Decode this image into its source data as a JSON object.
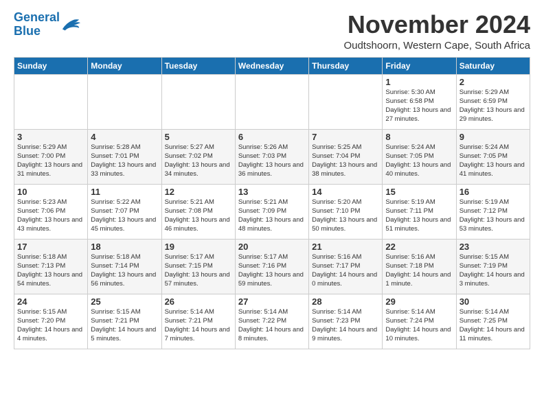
{
  "logo": {
    "line1": "General",
    "line2": "Blue"
  },
  "title": "November 2024",
  "location": "Oudtshoorn, Western Cape, South Africa",
  "weekdays": [
    "Sunday",
    "Monday",
    "Tuesday",
    "Wednesday",
    "Thursday",
    "Friday",
    "Saturday"
  ],
  "weeks": [
    [
      {
        "day": "",
        "info": ""
      },
      {
        "day": "",
        "info": ""
      },
      {
        "day": "",
        "info": ""
      },
      {
        "day": "",
        "info": ""
      },
      {
        "day": "",
        "info": ""
      },
      {
        "day": "1",
        "info": "Sunrise: 5:30 AM\nSunset: 6:58 PM\nDaylight: 13 hours\nand 27 minutes."
      },
      {
        "day": "2",
        "info": "Sunrise: 5:29 AM\nSunset: 6:59 PM\nDaylight: 13 hours\nand 29 minutes."
      }
    ],
    [
      {
        "day": "3",
        "info": "Sunrise: 5:29 AM\nSunset: 7:00 PM\nDaylight: 13 hours\nand 31 minutes."
      },
      {
        "day": "4",
        "info": "Sunrise: 5:28 AM\nSunset: 7:01 PM\nDaylight: 13 hours\nand 33 minutes."
      },
      {
        "day": "5",
        "info": "Sunrise: 5:27 AM\nSunset: 7:02 PM\nDaylight: 13 hours\nand 34 minutes."
      },
      {
        "day": "6",
        "info": "Sunrise: 5:26 AM\nSunset: 7:03 PM\nDaylight: 13 hours\nand 36 minutes."
      },
      {
        "day": "7",
        "info": "Sunrise: 5:25 AM\nSunset: 7:04 PM\nDaylight: 13 hours\nand 38 minutes."
      },
      {
        "day": "8",
        "info": "Sunrise: 5:24 AM\nSunset: 7:05 PM\nDaylight: 13 hours\nand 40 minutes."
      },
      {
        "day": "9",
        "info": "Sunrise: 5:24 AM\nSunset: 7:05 PM\nDaylight: 13 hours\nand 41 minutes."
      }
    ],
    [
      {
        "day": "10",
        "info": "Sunrise: 5:23 AM\nSunset: 7:06 PM\nDaylight: 13 hours\nand 43 minutes."
      },
      {
        "day": "11",
        "info": "Sunrise: 5:22 AM\nSunset: 7:07 PM\nDaylight: 13 hours\nand 45 minutes."
      },
      {
        "day": "12",
        "info": "Sunrise: 5:21 AM\nSunset: 7:08 PM\nDaylight: 13 hours\nand 46 minutes."
      },
      {
        "day": "13",
        "info": "Sunrise: 5:21 AM\nSunset: 7:09 PM\nDaylight: 13 hours\nand 48 minutes."
      },
      {
        "day": "14",
        "info": "Sunrise: 5:20 AM\nSunset: 7:10 PM\nDaylight: 13 hours\nand 50 minutes."
      },
      {
        "day": "15",
        "info": "Sunrise: 5:19 AM\nSunset: 7:11 PM\nDaylight: 13 hours\nand 51 minutes."
      },
      {
        "day": "16",
        "info": "Sunrise: 5:19 AM\nSunset: 7:12 PM\nDaylight: 13 hours\nand 53 minutes."
      }
    ],
    [
      {
        "day": "17",
        "info": "Sunrise: 5:18 AM\nSunset: 7:13 PM\nDaylight: 13 hours\nand 54 minutes."
      },
      {
        "day": "18",
        "info": "Sunrise: 5:18 AM\nSunset: 7:14 PM\nDaylight: 13 hours\nand 56 minutes."
      },
      {
        "day": "19",
        "info": "Sunrise: 5:17 AM\nSunset: 7:15 PM\nDaylight: 13 hours\nand 57 minutes."
      },
      {
        "day": "20",
        "info": "Sunrise: 5:17 AM\nSunset: 7:16 PM\nDaylight: 13 hours\nand 59 minutes."
      },
      {
        "day": "21",
        "info": "Sunrise: 5:16 AM\nSunset: 7:17 PM\nDaylight: 14 hours\nand 0 minutes."
      },
      {
        "day": "22",
        "info": "Sunrise: 5:16 AM\nSunset: 7:18 PM\nDaylight: 14 hours\nand 1 minute."
      },
      {
        "day": "23",
        "info": "Sunrise: 5:15 AM\nSunset: 7:19 PM\nDaylight: 14 hours\nand 3 minutes."
      }
    ],
    [
      {
        "day": "24",
        "info": "Sunrise: 5:15 AM\nSunset: 7:20 PM\nDaylight: 14 hours\nand 4 minutes."
      },
      {
        "day": "25",
        "info": "Sunrise: 5:15 AM\nSunset: 7:21 PM\nDaylight: 14 hours\nand 5 minutes."
      },
      {
        "day": "26",
        "info": "Sunrise: 5:14 AM\nSunset: 7:21 PM\nDaylight: 14 hours\nand 7 minutes."
      },
      {
        "day": "27",
        "info": "Sunrise: 5:14 AM\nSunset: 7:22 PM\nDaylight: 14 hours\nand 8 minutes."
      },
      {
        "day": "28",
        "info": "Sunrise: 5:14 AM\nSunset: 7:23 PM\nDaylight: 14 hours\nand 9 minutes."
      },
      {
        "day": "29",
        "info": "Sunrise: 5:14 AM\nSunset: 7:24 PM\nDaylight: 14 hours\nand 10 minutes."
      },
      {
        "day": "30",
        "info": "Sunrise: 5:14 AM\nSunset: 7:25 PM\nDaylight: 14 hours\nand 11 minutes."
      }
    ]
  ]
}
